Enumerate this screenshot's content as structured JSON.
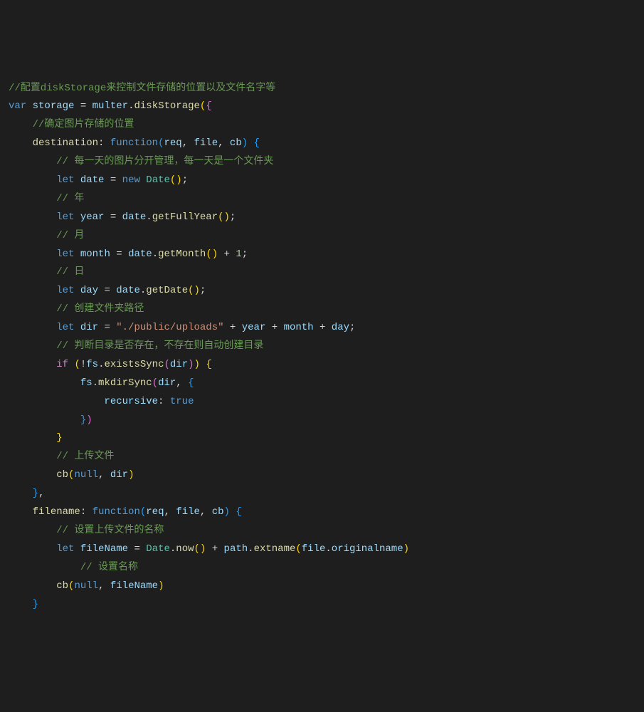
{
  "code": {
    "c1": "//配置diskStorage来控制文件存储的位置以及文件名字等",
    "l2_var": "var",
    "l2_storage": "storage",
    "l2_multer": "multer",
    "l2_diskStorage": "diskStorage",
    "c3": "//确定图片存储的位置",
    "l4_destination": "destination",
    "l4_function": "function",
    "l4_req": "req",
    "l4_file": "file",
    "l4_cb": "cb",
    "c5": "// 每一天的图片分开管理，每一天是一个文件夹",
    "l6_let": "let",
    "l6_date": "date",
    "l6_new": "new",
    "l6_Date": "Date",
    "c7": "// 年",
    "l8_let": "let",
    "l8_year": "year",
    "l8_date": "date",
    "l8_getFullYear": "getFullYear",
    "c9": "// 月",
    "l10_let": "let",
    "l10_month": "month",
    "l10_date": "date",
    "l10_getMonth": "getMonth",
    "l10_one": "1",
    "c11": "// 日",
    "l12_let": "let",
    "l12_day": "day",
    "l12_date": "date",
    "l12_getDate": "getDate",
    "c13": "// 创建文件夹路径",
    "l14_let": "let",
    "l14_dir": "dir",
    "l14_str": "\"./public/uploads\"",
    "l14_year": "year",
    "l14_month": "month",
    "l14_day": "day",
    "c15": "// 判断目录是否存在，不存在则自动创建目录",
    "l16_if": "if",
    "l16_fs": "fs",
    "l16_existsSync": "existsSync",
    "l16_dir": "dir",
    "l17_fs": "fs",
    "l17_mkdirSync": "mkdirSync",
    "l17_dir": "dir",
    "l18_recursive": "recursive",
    "l18_true": "true",
    "c21": "// 上传文件",
    "l22_cb": "cb",
    "l22_null": "null",
    "l22_dir": "dir",
    "l24_filename": "filename",
    "l24_function": "function",
    "l24_req": "req",
    "l24_file": "file",
    "l24_cb": "cb",
    "c25": "// 设置上传文件的名称",
    "l26_let": "let",
    "l26_fileName": "fileName",
    "l26_Date": "Date",
    "l26_now": "now",
    "l26_path": "path",
    "l26_extname": "extname",
    "l26_file": "file",
    "l26_originalname": "originalname",
    "c27": "// 设置名称",
    "l28_cb": "cb",
    "l28_null": "null",
    "l28_fileName": "fileName"
  }
}
